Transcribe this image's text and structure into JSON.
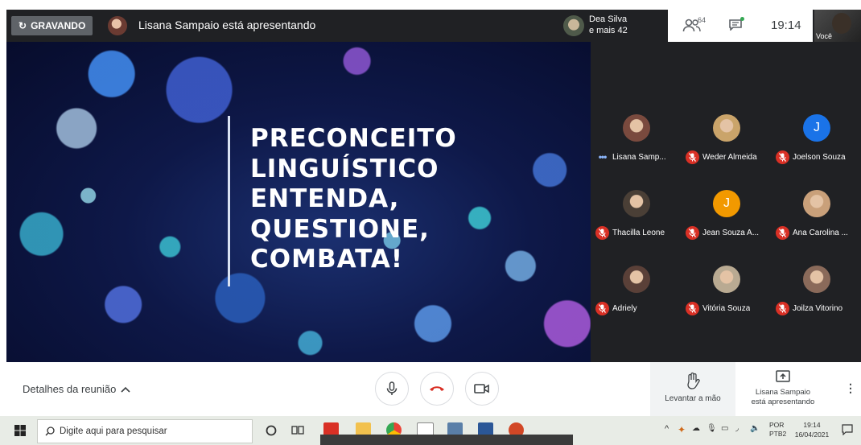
{
  "topbar": {
    "recording_label": "GRAVANDO",
    "presenting_text": "Lisana Sampaio está apresentando",
    "preview_name": "Dea Silva",
    "preview_more": "e mais 42",
    "people_count": "64",
    "clock": "19:14",
    "self_label": "Você"
  },
  "slide": {
    "lines": [
      "PRECONCEITO",
      "LINGUÍSTICO",
      "ENTENDA,",
      "QUESTIONE,",
      "COMBATA!"
    ]
  },
  "participants": [
    {
      "name": "Lisana Samp...",
      "initial": "",
      "state": "speaking",
      "color": "#7a4a3e"
    },
    {
      "name": "Weder Almeida",
      "initial": "",
      "state": "muted",
      "color": "#caa46a"
    },
    {
      "name": "Joelson Souza",
      "initial": "J",
      "state": "muted",
      "color": "#1a73e8"
    },
    {
      "name": "Thacilla Leone",
      "initial": "",
      "state": "muted",
      "color": "#4a3f36"
    },
    {
      "name": "Jean Souza A...",
      "initial": "J",
      "state": "muted",
      "color": "#f29900"
    },
    {
      "name": "Ana Carolina ...",
      "initial": "",
      "state": "muted",
      "color": "#c9a07a"
    },
    {
      "name": "Adriely",
      "initial": "",
      "state": "muted",
      "color": "#5a4038"
    },
    {
      "name": "Vitória Souza",
      "initial": "",
      "state": "muted",
      "color": "#b9aa92"
    },
    {
      "name": "Joilza Vitorino",
      "initial": "",
      "state": "muted",
      "color": "#8a6a5a"
    }
  ],
  "bottombar": {
    "details_label": "Detalhes da reunião",
    "raise_hand_label": "Levantar a mão",
    "presenter_label_1": "Lisana Sampaio",
    "presenter_label_2": "está apresentando"
  },
  "taskbar": {
    "search_placeholder": "Digite aqui para pesquisar",
    "lang_1": "POR",
    "lang_2": "PTB2",
    "time": "19:14",
    "date": "16/04/2021"
  },
  "colors": {
    "meet_dark": "#202124",
    "mute_red": "#d93025",
    "hangup_red": "#d93025",
    "accent_blue": "#1a73e8",
    "accent_orange": "#f29900"
  },
  "icons": [
    "mic-icon",
    "hangup-icon",
    "camera-icon",
    "hand-icon",
    "present-icon",
    "people-icon",
    "chat-icon",
    "windows-icon",
    "search-icon"
  ]
}
